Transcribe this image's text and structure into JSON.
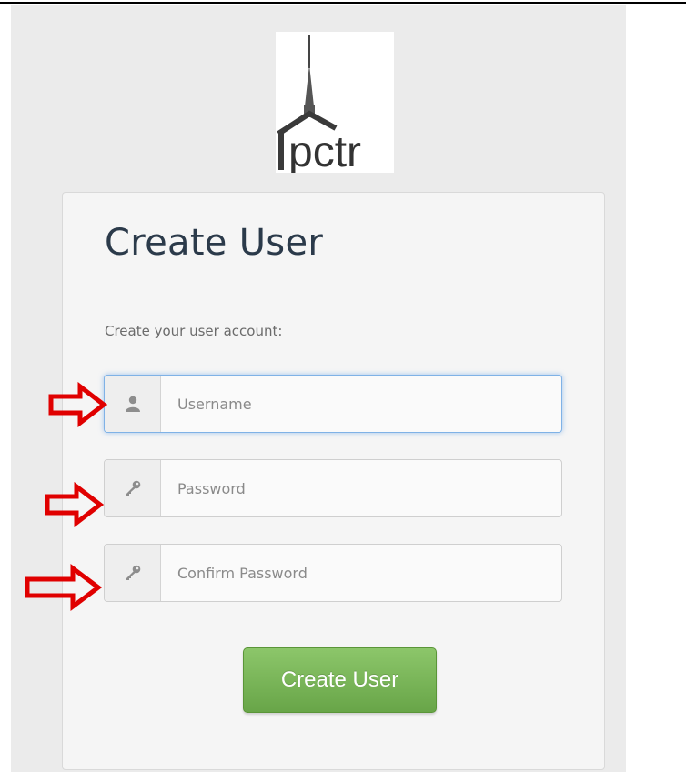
{
  "brand": {
    "logo_text": "pctr"
  },
  "form": {
    "title": "Create User",
    "subtitle": "Create your user account:",
    "fields": [
      {
        "placeholder": "Username",
        "value": "",
        "icon": "user-icon"
      },
      {
        "placeholder": "Password",
        "value": "",
        "icon": "key-icon"
      },
      {
        "placeholder": "Confirm Password",
        "value": "",
        "icon": "key-icon"
      }
    ],
    "submit_label": "Create User"
  },
  "colors": {
    "title": "#2b3a4a",
    "button": "#77b356",
    "focus_border": "#7fb2e6",
    "annotation_arrow": "#e00000"
  }
}
